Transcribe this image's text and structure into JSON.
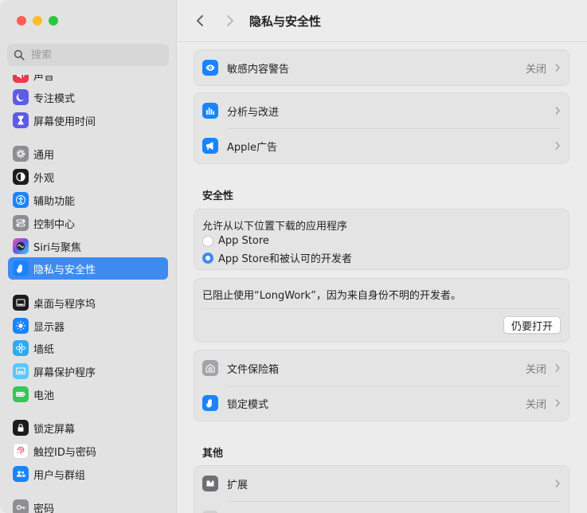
{
  "colors": {
    "accent": "#3e8bf0"
  },
  "window": {
    "traffic_lights": [
      "close",
      "minimize",
      "zoom"
    ]
  },
  "sidebar": {
    "search_placeholder": "搜索",
    "items": [
      {
        "label": "声音",
        "icon": "speaker-icon",
        "color": "#f2364f"
      },
      {
        "label": "专注模式",
        "icon": "moon-icon",
        "color": "#5e5ce6"
      },
      {
        "label": "屏幕使用时间",
        "icon": "hourglass-icon",
        "color": "#5e5ce6"
      },
      {
        "label": "通用",
        "icon": "gear-icon",
        "color": "#8e8e93"
      },
      {
        "label": "外观",
        "icon": "appearance-icon",
        "color": "#1c1c1e"
      },
      {
        "label": "辅助功能",
        "icon": "accessibility-icon",
        "color": "#1a84ff"
      },
      {
        "label": "控制中心",
        "icon": "control-center-icon",
        "color": "#8e8e93"
      },
      {
        "label": "Siri与聚焦",
        "icon": "siri-icon",
        "color": "#9d4edd"
      },
      {
        "label": "隐私与安全性",
        "icon": "hand-icon",
        "color": "#1a84ff"
      },
      {
        "label": "桌面与程序坞",
        "icon": "dock-icon",
        "color": "#1c1c1e"
      },
      {
        "label": "显示器",
        "icon": "sun-icon",
        "color": "#1a84ff"
      },
      {
        "label": "墙纸",
        "icon": "flower-icon",
        "color": "#31aaf2"
      },
      {
        "label": "屏幕保护程序",
        "icon": "screensaver-icon",
        "color": "#5ac8fa"
      },
      {
        "label": "电池",
        "icon": "battery-icon",
        "color": "#34c759"
      },
      {
        "label": "锁定屏幕",
        "icon": "lock-icon",
        "color": "#1c1c1e"
      },
      {
        "label": "触控ID与密码",
        "icon": "fingerprint-icon",
        "color": "#ffffff"
      },
      {
        "label": "用户与群组",
        "icon": "users-icon",
        "color": "#1a84ff"
      },
      {
        "label": "密码",
        "icon": "key-icon",
        "color": "#8e8e93"
      }
    ]
  },
  "toolbar": {
    "title": "隐私与安全性"
  },
  "main": {
    "sensitive": {
      "label": "敏感内容警告",
      "value": "关闭"
    },
    "analytics": {
      "label": "分析与改进"
    },
    "apple_ads": {
      "label": "Apple广告"
    },
    "security_title": "安全性",
    "allow": {
      "title": "允许从以下位置下载的应用程序",
      "options": [
        "App Store",
        "App Store和被认可的开发者"
      ],
      "selected_index": 1
    },
    "blocked": {
      "text": "已阻止使用“LongWork”，因为来自身份不明的开发者。",
      "button": "仍要打开"
    },
    "filevault": {
      "label": "文件保险箱",
      "value": "关闭"
    },
    "lockdown": {
      "label": "锁定模式",
      "value": "关闭"
    },
    "other_title": "其他",
    "extensions": {
      "label": "扩展"
    }
  }
}
